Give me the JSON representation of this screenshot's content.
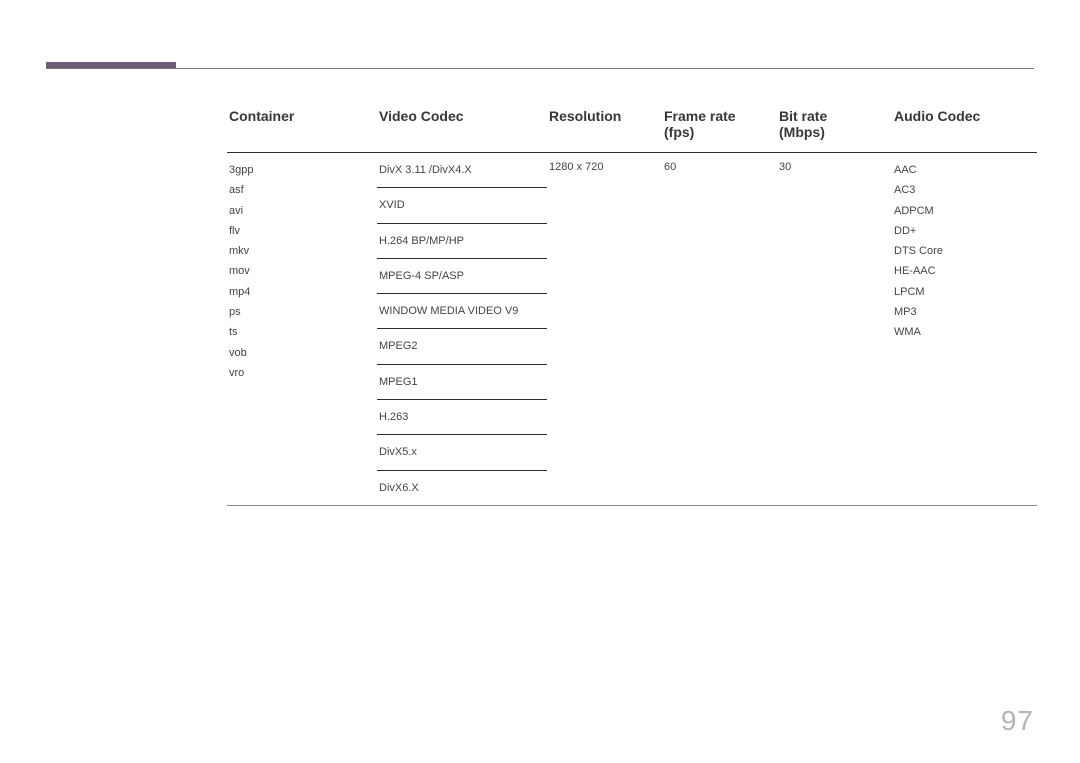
{
  "page_number": "97",
  "headers": {
    "container": "Container",
    "video_codec": "Video Codec",
    "resolution": "Resolution",
    "frame_rate_l1": "Frame rate",
    "frame_rate_l2": "(fps)",
    "bit_rate_l1": "Bit rate",
    "bit_rate_l2": "(Mbps)",
    "audio_codec": "Audio Codec"
  },
  "containers": [
    "3gpp",
    "asf",
    "avi",
    "flv",
    "mkv",
    "mov",
    "mp4",
    "ps",
    "ts",
    "vob",
    "vro"
  ],
  "video_codecs": [
    "DivX 3.11 /DivX4.X",
    "XVID",
    "H.264 BP/MP/HP",
    "MPEG-4 SP/ASP",
    "WINDOW MEDIA VIDEO V9",
    "MPEG2",
    "MPEG1",
    "H.263",
    "DivX5.x",
    "DivX6.X"
  ],
  "resolution": "1280 x 720",
  "frame_rate": "60",
  "bit_rate": "30",
  "audio_codecs": [
    "AAC",
    "AC3",
    "ADPCM",
    "DD+",
    "DTS Core",
    "HE-AAC",
    "LPCM",
    "MP3",
    "WMA"
  ]
}
